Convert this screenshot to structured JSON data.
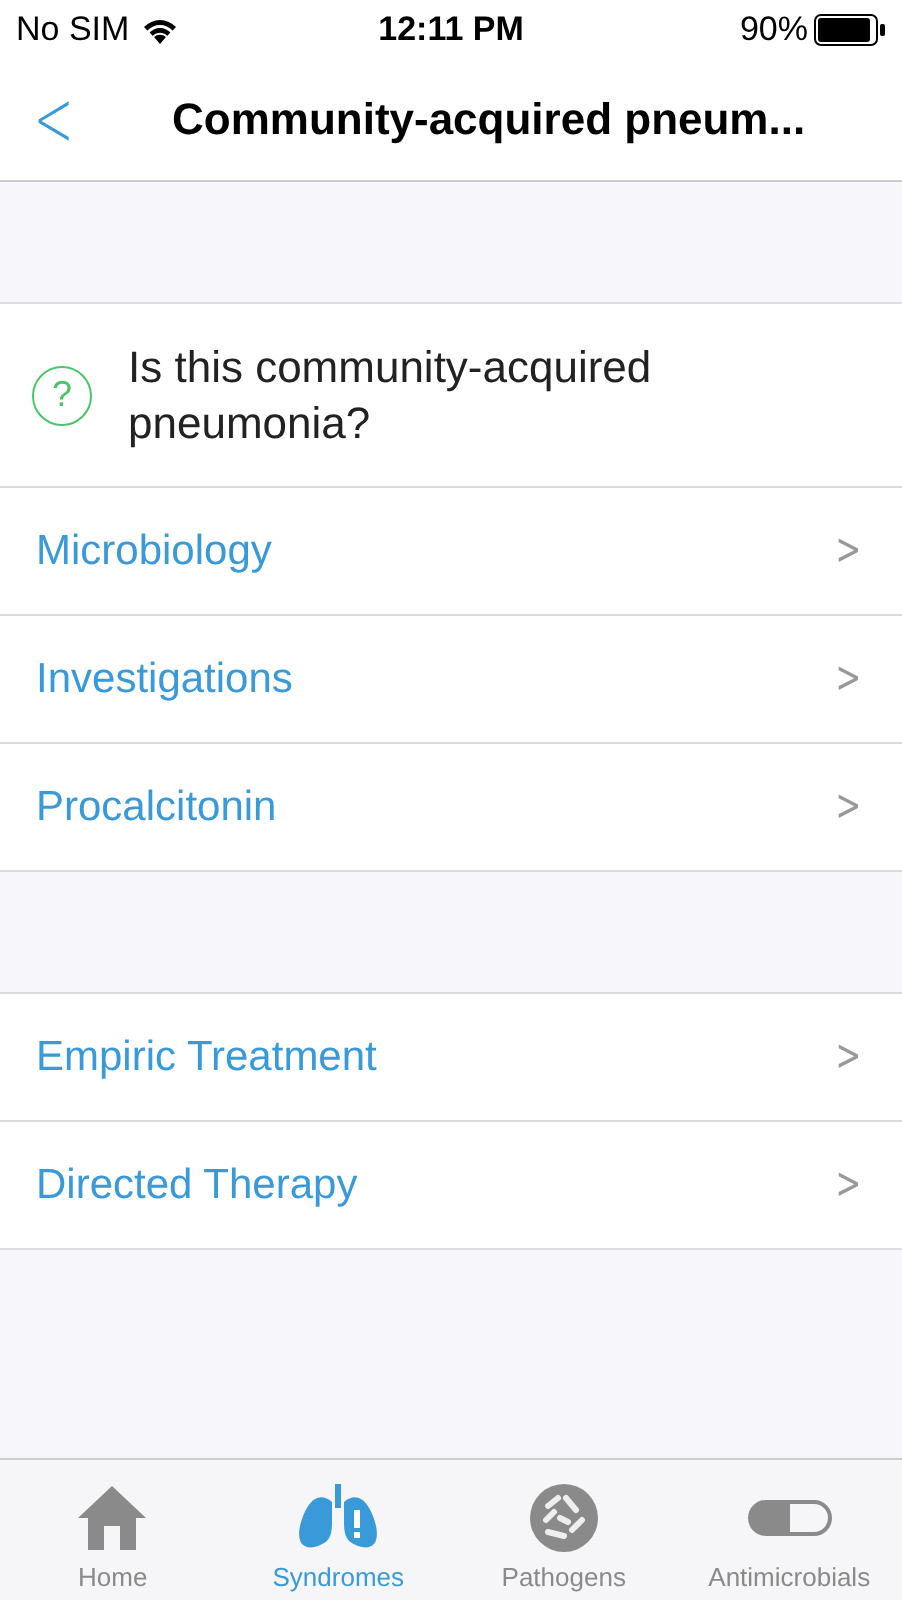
{
  "status_bar": {
    "carrier": "No SIM",
    "time": "12:11 PM",
    "battery": "90%"
  },
  "nav": {
    "back": "<",
    "title": "Community-acquired pneum..."
  },
  "question": {
    "icon": "?",
    "text": "Is this community-acquired pneumonia?"
  },
  "sections": [
    {
      "rows": [
        {
          "label": "Microbiology",
          "chevron": ">"
        },
        {
          "label": "Investigations",
          "chevron": ">"
        },
        {
          "label": "Procalcitonin",
          "chevron": ">"
        }
      ]
    },
    {
      "rows": [
        {
          "label": "Empiric Treatment",
          "chevron": ">"
        },
        {
          "label": "Directed Therapy",
          "chevron": ">"
        }
      ]
    }
  ],
  "tabs": [
    {
      "kind": "home",
      "label": "Home",
      "selected": false
    },
    {
      "kind": "lungs",
      "label": "Syndromes",
      "selected": true
    },
    {
      "kind": "pathogens",
      "label": "Pathogens",
      "selected": false
    },
    {
      "kind": "pill",
      "label": "Antimicrobials",
      "selected": false
    }
  ]
}
